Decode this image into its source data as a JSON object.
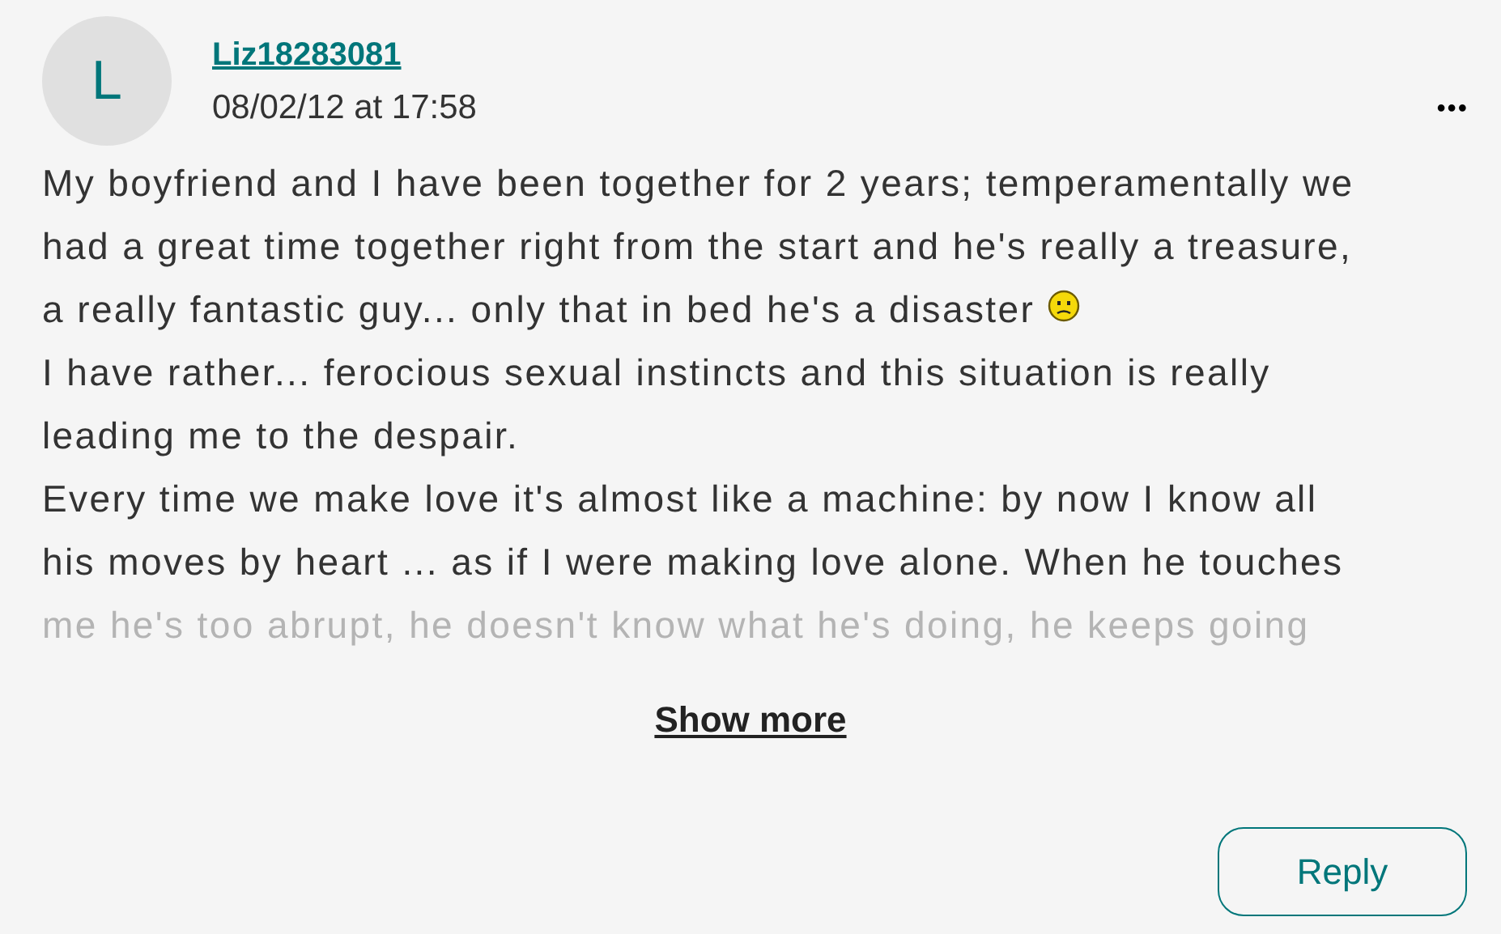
{
  "post": {
    "avatar_letter": "L",
    "author": "Liz18283081",
    "timestamp": "08/02/12 at 17:58",
    "menu_icon": "•••",
    "lines": [
      {
        "text": "My boyfriend and I have been together for 2 years; temperamentally we",
        "emoji": false,
        "faded": false
      },
      {
        "text": "had a great time together right from the start and he's really a treasure,",
        "emoji": false,
        "faded": false
      },
      {
        "text": "a really fantastic guy... only that in bed he's a disaster",
        "emoji": true,
        "faded": false
      },
      {
        "text": "I have rather... ferocious sexual instincts and this situation is really",
        "emoji": false,
        "faded": false
      },
      {
        "text": "leading me to the despair.",
        "emoji": false,
        "faded": false
      },
      {
        "text": "Every time we make love it's almost like a machine: by now I know all",
        "emoji": false,
        "faded": false
      },
      {
        "text": "his moves by heart ... as if I were making love alone. When he touches",
        "emoji": false,
        "faded": false
      },
      {
        "text": "me he's too abrupt, he doesn't know what he's doing, he keeps going",
        "emoji": false,
        "faded": true
      }
    ],
    "show_more": "Show more",
    "reply_button": "Reply"
  }
}
